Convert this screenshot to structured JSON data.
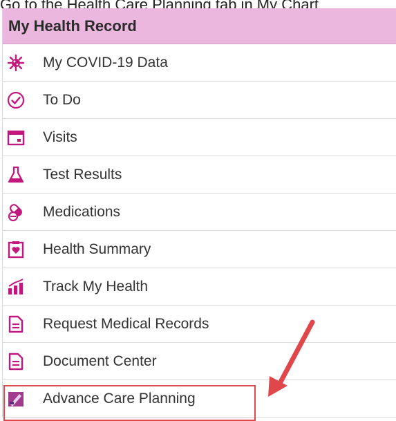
{
  "partial_top_text": "Go to the Health Care Planning tab in My Chart",
  "header": {
    "title": "My Health Record"
  },
  "menu": {
    "items": [
      {
        "label": "My COVID-19 Data",
        "icon": "covid-virus-icon"
      },
      {
        "label": "To Do",
        "icon": "checkmark-clock-icon"
      },
      {
        "label": "Visits",
        "icon": "calendar-icon"
      },
      {
        "label": "Test Results",
        "icon": "flask-icon"
      },
      {
        "label": "Medications",
        "icon": "pills-icon"
      },
      {
        "label": "Health Summary",
        "icon": "heart-clipboard-icon"
      },
      {
        "label": "Track My Health",
        "icon": "bar-chart-icon"
      },
      {
        "label": "Request Medical Records",
        "icon": "document-icon"
      },
      {
        "label": "Document Center",
        "icon": "document-icon"
      },
      {
        "label": "Advance Care Planning",
        "icon": "care-planning-icon"
      }
    ]
  },
  "colors": {
    "accent": "#c2187d",
    "header_bg": "#ebb7df",
    "highlight": "#e0474b"
  }
}
